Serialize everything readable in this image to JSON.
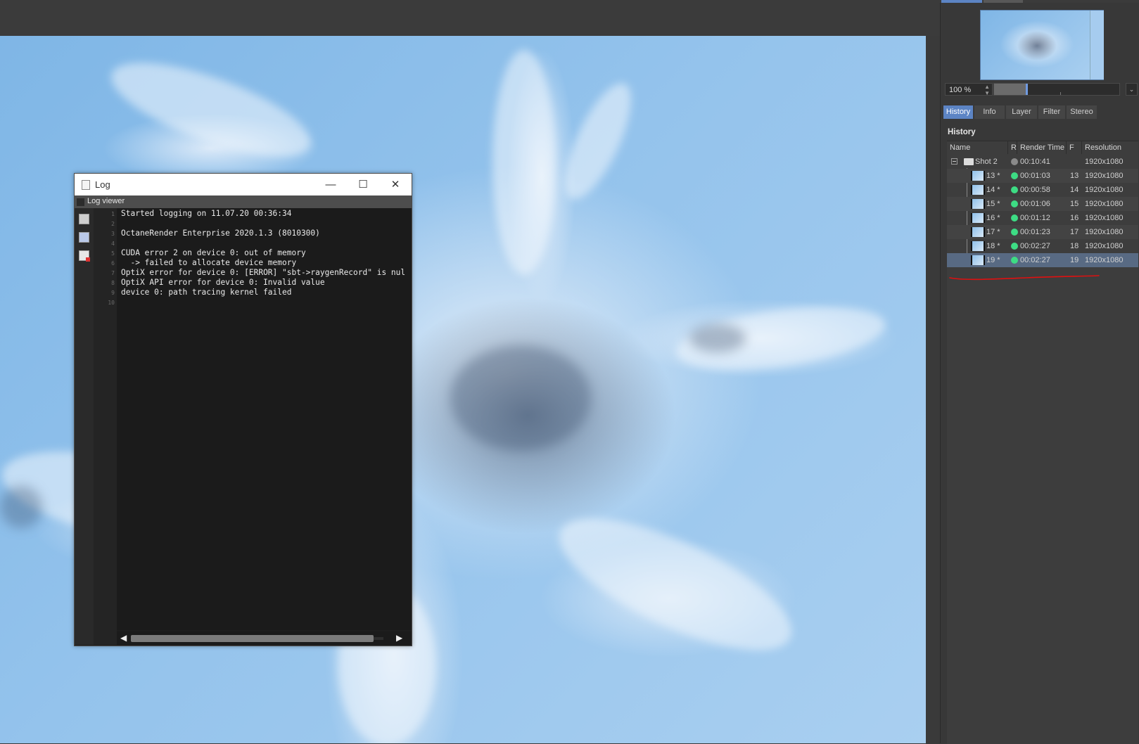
{
  "log_window": {
    "title": "Log",
    "viewer_label": "Log viewer",
    "line_numbers": [
      "1",
      "2",
      "3",
      "4",
      "5",
      "6",
      "7",
      "8",
      "9",
      "10"
    ],
    "lines": [
      "Started logging on 11.07.20 00:36:34",
      "",
      "OctaneRender Enterprise 2020.1.3 (8010300)",
      "",
      "CUDA error 2 on device 0: out of memory",
      "  -> failed to allocate device memory",
      "OptiX error for device 0: [ERROR] \"sbt->raygenRecord\" is nul",
      "OptiX API error for device 0: Invalid value",
      "device 0: path tracing kernel failed",
      ""
    ],
    "min_glyph": "—",
    "max_glyph": "☐",
    "close_glyph": "✕",
    "scroll_left_glyph": "◀",
    "scroll_right_glyph": "▶"
  },
  "right_panel": {
    "zoom_value": "100 %",
    "zoom_slider_fraction": 0.25,
    "dropdown_glyph": "⌄",
    "tabs": [
      "History",
      "Info",
      "Layer",
      "Filter",
      "Stereo"
    ],
    "active_tab": "History",
    "history_title": "History",
    "columns": {
      "name": "Name",
      "r": "R",
      "render_time": "Render Time",
      "f": "F",
      "resolution": "Resolution"
    },
    "group": {
      "name": "Shot 2",
      "render_time": "00:10:41",
      "resolution": "1920x1080",
      "status_color": "#8a8a8a"
    },
    "rows": [
      {
        "name": "13 *",
        "render_time": "00:01:03",
        "f": "13",
        "resolution": "1920x1080",
        "status_color": "#3ddc84",
        "selected": false
      },
      {
        "name": "14 *",
        "render_time": "00:00:58",
        "f": "14",
        "resolution": "1920x1080",
        "status_color": "#3ddc84",
        "selected": false
      },
      {
        "name": "15 *",
        "render_time": "00:01:06",
        "f": "15",
        "resolution": "1920x1080",
        "status_color": "#3ddc84",
        "selected": false
      },
      {
        "name": "16 *",
        "render_time": "00:01:12",
        "f": "16",
        "resolution": "1920x1080",
        "status_color": "#3ddc84",
        "selected": false
      },
      {
        "name": "17 *",
        "render_time": "00:01:23",
        "f": "17",
        "resolution": "1920x1080",
        "status_color": "#3ddc84",
        "selected": false
      },
      {
        "name": "18 *",
        "render_time": "00:02:27",
        "f": "18",
        "resolution": "1920x1080",
        "status_color": "#3ddc84",
        "selected": false
      },
      {
        "name": "19 *",
        "render_time": "00:02:27",
        "f": "19",
        "resolution": "1920x1080",
        "status_color": "#3ddc84",
        "selected": true
      }
    ],
    "annotation_color": "#e01010"
  },
  "colors": {
    "accent": "#5c84c4",
    "selected_row": "#586a83",
    "panel_bg": "#383838"
  }
}
